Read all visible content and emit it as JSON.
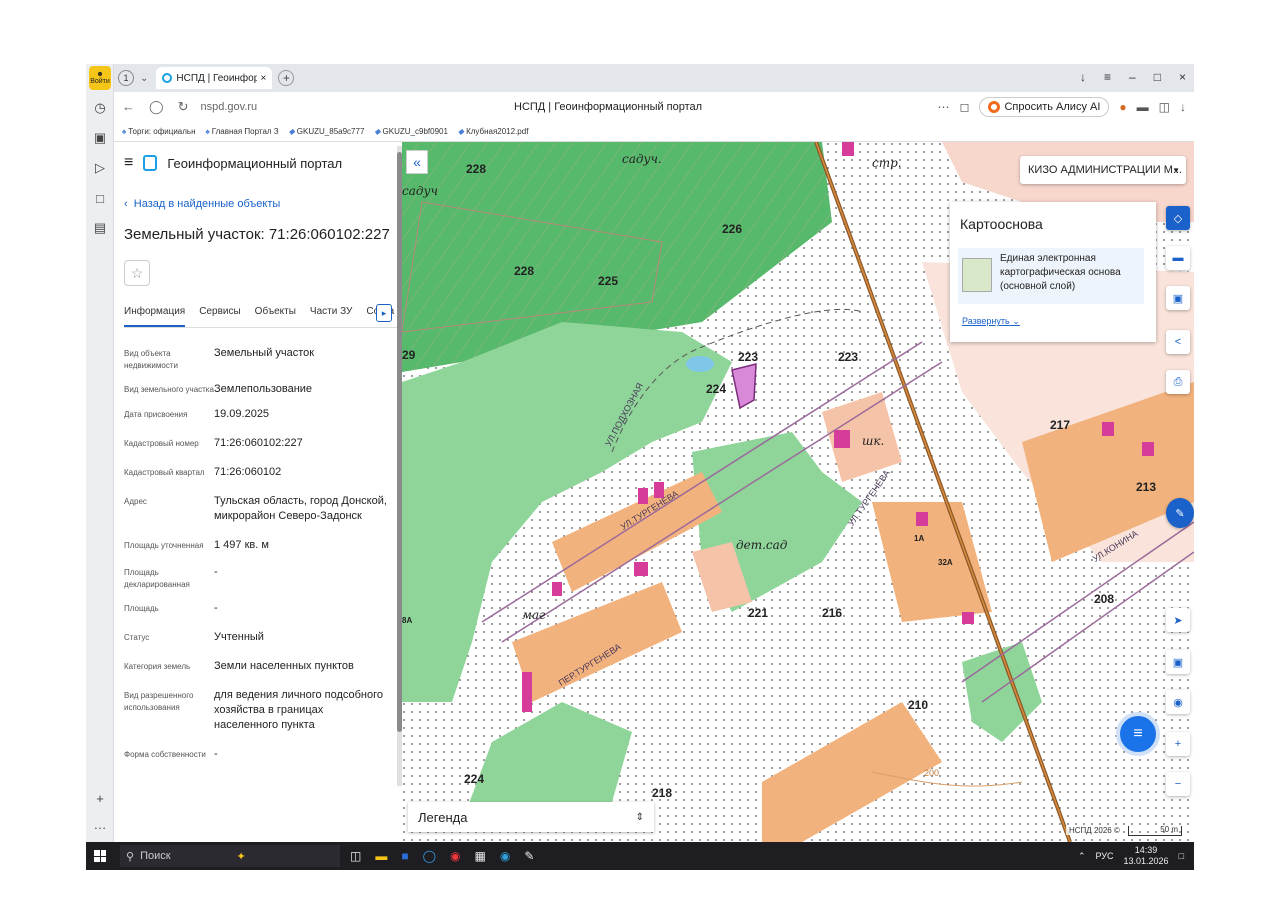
{
  "browser": {
    "tab_count": "1",
    "tab_title": "НСПД | Геоинформаци",
    "url": "nspd.gov.ru",
    "page_title": "НСПД | Геоинформационный портал",
    "alice_label": "Спросить Алису AI",
    "login_label": "Войти",
    "bookmarks": [
      "Торги: официальн",
      "Главная Портал З",
      "GKUZU_85a9c777",
      "GKUZU_c9bf0901",
      "Клубная2012.pdf"
    ]
  },
  "panel": {
    "app_title": "Геоинформационный портал",
    "back_link": "Назад в найденные объекты",
    "title": "Земельный участок: 71:26:060102:227",
    "tabs": [
      "Информация",
      "Сервисы",
      "Объекты",
      "Части ЗУ",
      "Соста"
    ],
    "attributes": [
      {
        "key": "Вид объекта недвижимости",
        "value": "Земельный участок"
      },
      {
        "key": "Вид земельного участка",
        "value": "Землепользование"
      },
      {
        "key": "Дата присвоения",
        "value": "19.09.2025"
      },
      {
        "key": "Кадастровый номер",
        "value": "71:26:060102:227"
      },
      {
        "key": "Кадастровый квартал",
        "value": "71:26:060102"
      },
      {
        "key": "Адрес",
        "value": "Тульская область, город Донской, микрорайон Северо-Задонск"
      },
      {
        "key": "Площадь уточненная",
        "value": "1 497 кв. м"
      },
      {
        "key": "Площадь декларированная",
        "value": "-"
      },
      {
        "key": "Площадь",
        "value": "-"
      },
      {
        "key": "Статус",
        "value": "Учтенный"
      },
      {
        "key": "Категория земель",
        "value": "Земли населенных пунктов"
      },
      {
        "key": "Вид разрешенного использования",
        "value": "для ведения личного подсобного хозяйства в границах населенного пункта"
      },
      {
        "key": "Форма собственности",
        "value": "-"
      }
    ]
  },
  "map": {
    "layer_select": "КИЗО АДМИНИСТРАЦИИ М...",
    "basemap_title": "Картооснова",
    "basemap_item": "Единая электронная картографическая основа (основной слой)",
    "expand_link": "Развернуть",
    "legend_label": "Легенда",
    "attribution": "НСПД 2026 ©",
    "scale": "50 m",
    "labels": {
      "l228a": "228",
      "l228b": "228",
      "l226": "226",
      "l225": "225",
      "sadyuch1": "садуч.",
      "sadyuch2": "садуч",
      "l29": "29",
      "l223a": "223",
      "l223b": "223",
      "l224a": "224",
      "l224b": "224",
      "street_khoz": "УЛ.ПОДХОЗНАЯ",
      "street_turg1": "УЛ.ТУРГЕНЕВА",
      "street_turg2": "УЛ.ТУРГЕНЕВА",
      "street_turg3": "ПЕР.ТУРГЕНЕВА",
      "shk": "шк.",
      "detsad": "дет.сад",
      "mag": "маг",
      "str": "стр.",
      "l221": "221",
      "l216": "216",
      "l217": "217",
      "l213": "213",
      "l208": "208",
      "l210": "210",
      "l218": "218",
      "street_kon": "УЛ.КОНИНА",
      "contour200": "200",
      "l8a": "8А",
      "l32a": "32А",
      "l1a": "1А"
    }
  },
  "taskbar": {
    "search_placeholder": "Поиск",
    "lang": "РУС",
    "time": "14:39",
    "date": "13.01.2026"
  }
}
